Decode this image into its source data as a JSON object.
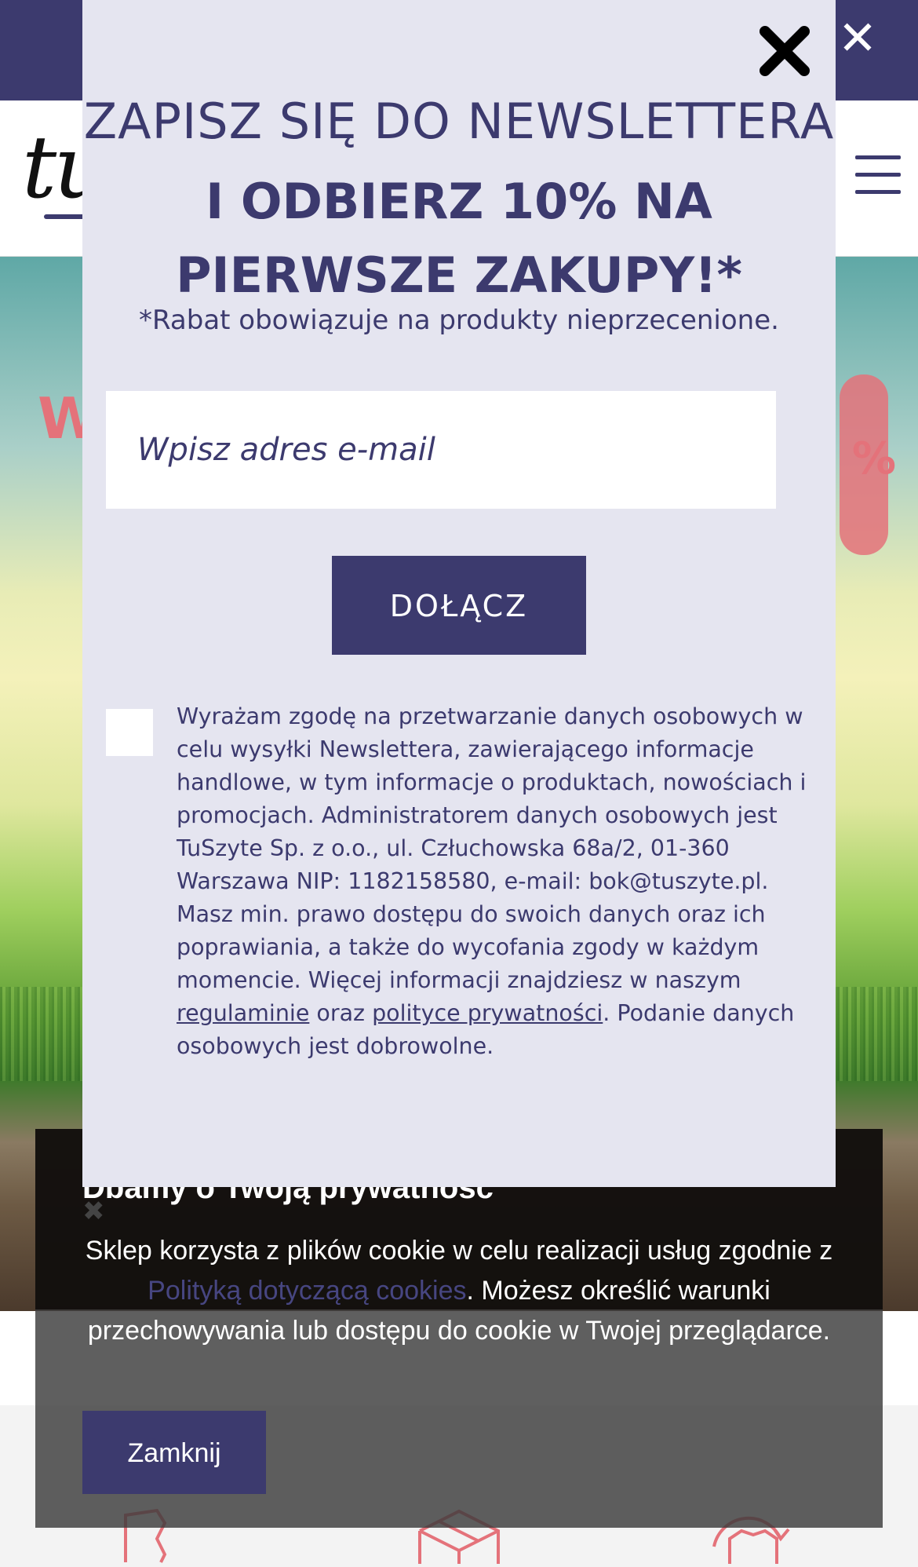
{
  "topbar": {
    "close_icon": "close-icon"
  },
  "header": {
    "logo_text": "tu",
    "menu_icon": "hamburger-icon"
  },
  "hero": {
    "word_left": "W",
    "pct": "%"
  },
  "newsletter": {
    "title_line1": "ZAPISZ SIĘ DO NEWSLETTERA",
    "title_line2": "I ODBIERZ 10% NA PIERWSZE ZAKUPY!*",
    "note": "*Rabat obowiązuje na produkty nieprzecenione.",
    "email_placeholder": "Wpisz adres e-mail",
    "join_label": "DOŁĄCZ",
    "consent_before": "Wyrażam zgodę na przetwarzanie danych osobowych w celu wysyłki Newslettera, zawierającego informacje handlowe, w tym informacje o produktach, nowościach i promocjach. Administratorem danych osobowych jest TuSzyte Sp. z o.o., ul. Człuchowska 68a/2, 01-360 Warszawa NIP: 1182158580, e-mail: bok@tuszyte.pl. Masz min. prawo dostępu do swoich danych oraz ich poprawiania, a także do wycofania zgody w każdym momencie. Więcej informacji znajdziesz w naszym ",
    "link_regulamin": "regulaminie",
    "consent_between": " oraz ",
    "link_privacy": "polityce prywatności",
    "consent_after": ". Podanie danych osobowych jest dobrowolne."
  },
  "cookie": {
    "title": "Dbamy o Twoją prywatność",
    "text_before": "Sklep korzysta z plików cookie w celu realizacji usług zgodnie z ",
    "link": "Polityką dotyczącą cookies",
    "text_after": ". Możesz określić warunki przechowywania lub dostępu do cookie w Twojej przeglądarce.",
    "close_label": "Zamknij"
  },
  "colors": {
    "brand": "#3c3a6e",
    "modal_bg": "#e5e5f0",
    "accent_pink": "#e4727a"
  }
}
